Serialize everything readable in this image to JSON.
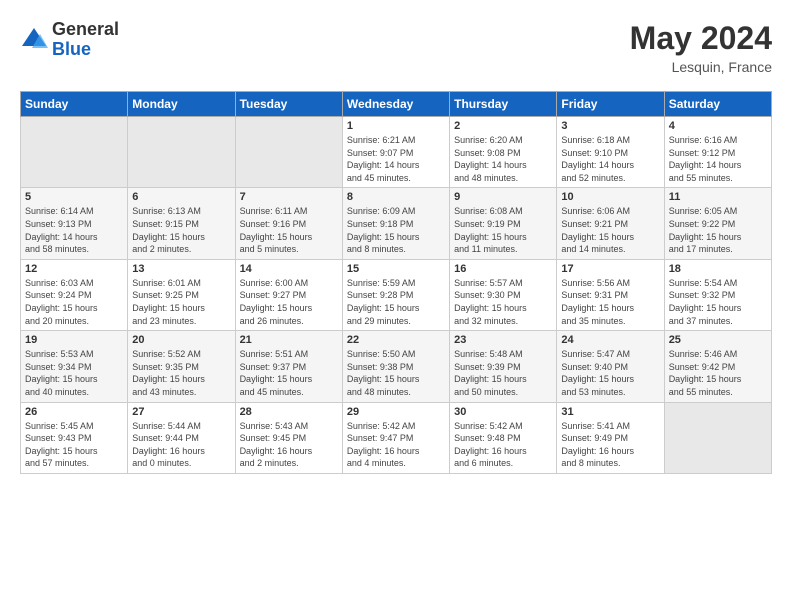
{
  "logo": {
    "general": "General",
    "blue": "Blue"
  },
  "title": {
    "month_year": "May 2024",
    "location": "Lesquin, France"
  },
  "headers": [
    "Sunday",
    "Monday",
    "Tuesday",
    "Wednesday",
    "Thursday",
    "Friday",
    "Saturday"
  ],
  "weeks": [
    [
      {
        "day": "",
        "info": ""
      },
      {
        "day": "",
        "info": ""
      },
      {
        "day": "",
        "info": ""
      },
      {
        "day": "1",
        "info": "Sunrise: 6:21 AM\nSunset: 9:07 PM\nDaylight: 14 hours\nand 45 minutes."
      },
      {
        "day": "2",
        "info": "Sunrise: 6:20 AM\nSunset: 9:08 PM\nDaylight: 14 hours\nand 48 minutes."
      },
      {
        "day": "3",
        "info": "Sunrise: 6:18 AM\nSunset: 9:10 PM\nDaylight: 14 hours\nand 52 minutes."
      },
      {
        "day": "4",
        "info": "Sunrise: 6:16 AM\nSunset: 9:12 PM\nDaylight: 14 hours\nand 55 minutes."
      }
    ],
    [
      {
        "day": "5",
        "info": "Sunrise: 6:14 AM\nSunset: 9:13 PM\nDaylight: 14 hours\nand 58 minutes."
      },
      {
        "day": "6",
        "info": "Sunrise: 6:13 AM\nSunset: 9:15 PM\nDaylight: 15 hours\nand 2 minutes."
      },
      {
        "day": "7",
        "info": "Sunrise: 6:11 AM\nSunset: 9:16 PM\nDaylight: 15 hours\nand 5 minutes."
      },
      {
        "day": "8",
        "info": "Sunrise: 6:09 AM\nSunset: 9:18 PM\nDaylight: 15 hours\nand 8 minutes."
      },
      {
        "day": "9",
        "info": "Sunrise: 6:08 AM\nSunset: 9:19 PM\nDaylight: 15 hours\nand 11 minutes."
      },
      {
        "day": "10",
        "info": "Sunrise: 6:06 AM\nSunset: 9:21 PM\nDaylight: 15 hours\nand 14 minutes."
      },
      {
        "day": "11",
        "info": "Sunrise: 6:05 AM\nSunset: 9:22 PM\nDaylight: 15 hours\nand 17 minutes."
      }
    ],
    [
      {
        "day": "12",
        "info": "Sunrise: 6:03 AM\nSunset: 9:24 PM\nDaylight: 15 hours\nand 20 minutes."
      },
      {
        "day": "13",
        "info": "Sunrise: 6:01 AM\nSunset: 9:25 PM\nDaylight: 15 hours\nand 23 minutes."
      },
      {
        "day": "14",
        "info": "Sunrise: 6:00 AM\nSunset: 9:27 PM\nDaylight: 15 hours\nand 26 minutes."
      },
      {
        "day": "15",
        "info": "Sunrise: 5:59 AM\nSunset: 9:28 PM\nDaylight: 15 hours\nand 29 minutes."
      },
      {
        "day": "16",
        "info": "Sunrise: 5:57 AM\nSunset: 9:30 PM\nDaylight: 15 hours\nand 32 minutes."
      },
      {
        "day": "17",
        "info": "Sunrise: 5:56 AM\nSunset: 9:31 PM\nDaylight: 15 hours\nand 35 minutes."
      },
      {
        "day": "18",
        "info": "Sunrise: 5:54 AM\nSunset: 9:32 PM\nDaylight: 15 hours\nand 37 minutes."
      }
    ],
    [
      {
        "day": "19",
        "info": "Sunrise: 5:53 AM\nSunset: 9:34 PM\nDaylight: 15 hours\nand 40 minutes."
      },
      {
        "day": "20",
        "info": "Sunrise: 5:52 AM\nSunset: 9:35 PM\nDaylight: 15 hours\nand 43 minutes."
      },
      {
        "day": "21",
        "info": "Sunrise: 5:51 AM\nSunset: 9:37 PM\nDaylight: 15 hours\nand 45 minutes."
      },
      {
        "day": "22",
        "info": "Sunrise: 5:50 AM\nSunset: 9:38 PM\nDaylight: 15 hours\nand 48 minutes."
      },
      {
        "day": "23",
        "info": "Sunrise: 5:48 AM\nSunset: 9:39 PM\nDaylight: 15 hours\nand 50 minutes."
      },
      {
        "day": "24",
        "info": "Sunrise: 5:47 AM\nSunset: 9:40 PM\nDaylight: 15 hours\nand 53 minutes."
      },
      {
        "day": "25",
        "info": "Sunrise: 5:46 AM\nSunset: 9:42 PM\nDaylight: 15 hours\nand 55 minutes."
      }
    ],
    [
      {
        "day": "26",
        "info": "Sunrise: 5:45 AM\nSunset: 9:43 PM\nDaylight: 15 hours\nand 57 minutes."
      },
      {
        "day": "27",
        "info": "Sunrise: 5:44 AM\nSunset: 9:44 PM\nDaylight: 16 hours\nand 0 minutes."
      },
      {
        "day": "28",
        "info": "Sunrise: 5:43 AM\nSunset: 9:45 PM\nDaylight: 16 hours\nand 2 minutes."
      },
      {
        "day": "29",
        "info": "Sunrise: 5:42 AM\nSunset: 9:47 PM\nDaylight: 16 hours\nand 4 minutes."
      },
      {
        "day": "30",
        "info": "Sunrise: 5:42 AM\nSunset: 9:48 PM\nDaylight: 16 hours\nand 6 minutes."
      },
      {
        "day": "31",
        "info": "Sunrise: 5:41 AM\nSunset: 9:49 PM\nDaylight: 16 hours\nand 8 minutes."
      },
      {
        "day": "",
        "info": ""
      }
    ]
  ]
}
